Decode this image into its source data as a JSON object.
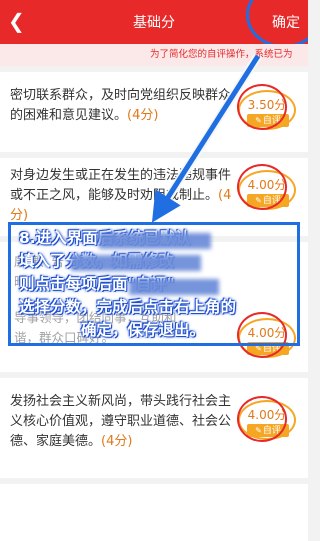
{
  "header": {
    "back_icon": "chevron-left-icon",
    "title": "基础分",
    "confirm_label": "确定"
  },
  "notice": "为了简化您的自评操作，系统已为",
  "items": [
    {
      "text": "密切联系群众，及时向党组织反映群众的困难和意见建议。",
      "points": "(4分)",
      "score": "3.50分",
      "button": "自评"
    },
    {
      "text": "对身边发生或正在发生的违法违规事件或不正之风，能够及时劝阻或制止。",
      "points": "(4分)",
      "score": "4.00分",
      "button": "自评"
    },
    {
      "text": "",
      "points": "",
      "score": "",
      "button": ""
    },
    {
      "text": "",
      "points": "",
      "score": "4.00分",
      "button": "自评"
    },
    {
      "text": "发扬社会主义新风尚，带头践行社会主义核心价值观，遵守职业道德、社会公德、家庭美德。",
      "points": "(4分)",
      "score": "4.00分",
      "button": "自评"
    }
  ],
  "partially_visible": {
    "item3_line1": "康健、告",
    "item3_line2": "暗",
    "item4_line1": "导事领导，团结同事，互助和",
    "item4_line2": "谐，群众口碑好。"
  },
  "annotation": {
    "line1": "8.进入界面后系统已默认",
    "line2": "填入了分数，如需修改",
    "line3": "则点击每项后面\"自评\"",
    "line4": "选择分数，完成后点击右上角的",
    "line5": "确定，保存退出。"
  },
  "colors": {
    "header": "#e7292a",
    "accent": "#f5a623",
    "annotation": "#1f6fe3"
  }
}
